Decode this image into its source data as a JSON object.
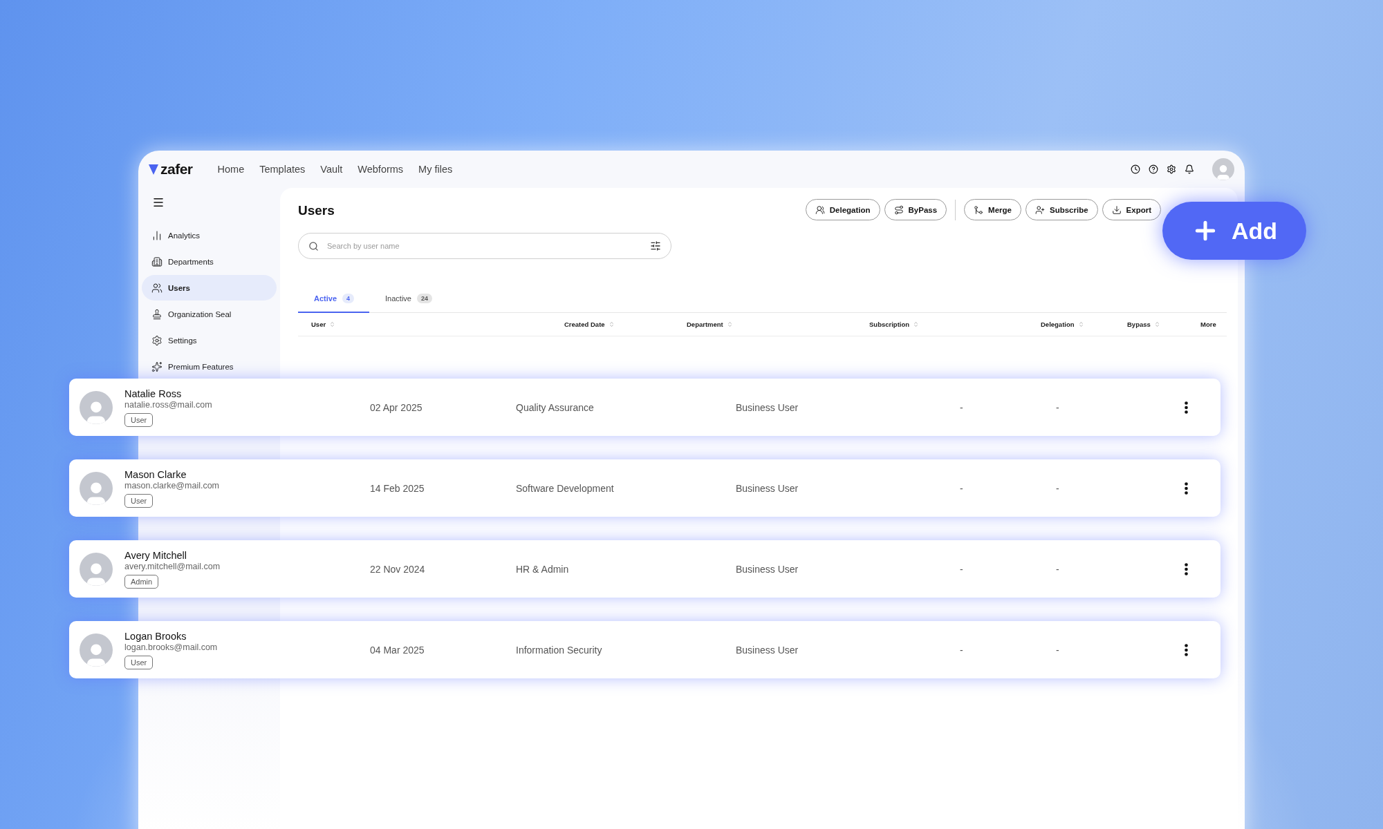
{
  "brand": "zafer",
  "nav": [
    {
      "label": "Home"
    },
    {
      "label": "Templates"
    },
    {
      "label": "Vault"
    },
    {
      "label": "Webforms"
    },
    {
      "label": "My files"
    }
  ],
  "sidebar": {
    "items": [
      {
        "label": "Analytics",
        "kind": "analytics",
        "selected": false
      },
      {
        "label": "Departments",
        "kind": "departments",
        "selected": false
      },
      {
        "label": "Users",
        "kind": "users",
        "selected": true
      },
      {
        "label": "Organization Seal",
        "kind": "seal",
        "selected": false
      },
      {
        "label": "Settings",
        "kind": "settings",
        "selected": false
      },
      {
        "label": "Premium Features",
        "kind": "premium",
        "selected": false
      }
    ]
  },
  "page_title": "Users",
  "toolbar": [
    {
      "label": "Delegation",
      "kind": "delegation"
    },
    {
      "label": "ByPass",
      "kind": "bypass"
    },
    {
      "label": "Merge",
      "kind": "merge"
    },
    {
      "label": "Subscribe",
      "kind": "subscribe"
    },
    {
      "label": "Export",
      "kind": "export"
    }
  ],
  "add_button": {
    "label": "Add"
  },
  "search": {
    "placeholder": "Search by user name"
  },
  "tabs": [
    {
      "label": "Active",
      "count": "4",
      "selected": true
    },
    {
      "label": "Inactive",
      "count": "24",
      "selected": false
    }
  ],
  "table": {
    "columns": [
      {
        "label": "User",
        "sortable": true
      },
      {
        "label": "Created Date",
        "sortable": true
      },
      {
        "label": "Department",
        "sortable": true
      },
      {
        "label": "Subscription",
        "sortable": true
      },
      {
        "label": "Delegation",
        "sortable": true
      },
      {
        "label": "Bypass",
        "sortable": true
      },
      {
        "label": "More",
        "sortable": false
      }
    ],
    "rows": [
      {
        "name": "Natalie Ross",
        "email": "natalie.ross@mail.com",
        "role": "User",
        "created": "02 Apr 2025",
        "department": "Quality Assurance",
        "subscription": "Business User",
        "delegation": "-",
        "bypass": "-"
      },
      {
        "name": "Mason Clarke",
        "email": "mason.clarke@mail.com",
        "role": "User",
        "created": "14 Feb 2025",
        "department": "Software Development",
        "subscription": "Business User",
        "delegation": "-",
        "bypass": "-"
      },
      {
        "name": "Avery Mitchell",
        "email": "avery.mitchell@mail.com",
        "role": "Admin",
        "created": "22 Nov 2024",
        "department": "HR & Admin",
        "subscription": "Business User",
        "delegation": "-",
        "bypass": "-"
      },
      {
        "name": "Logan Brooks",
        "email": "logan.brooks@mail.com",
        "role": "User",
        "created": "04 Mar 2025",
        "department": "Information Security",
        "subscription": "Business User",
        "delegation": "-",
        "bypass": "-"
      }
    ]
  }
}
